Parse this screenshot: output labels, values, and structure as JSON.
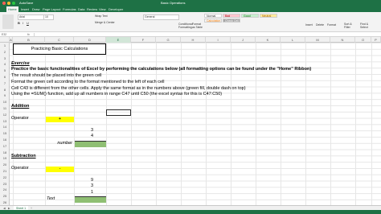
{
  "window": {
    "title": "Basic Operations",
    "autosave_label": "AutoSave"
  },
  "menu": {
    "tabs": [
      "Home",
      "Insert",
      "Draw",
      "Page Layout",
      "Formulas",
      "Data",
      "Review",
      "View",
      "Developer"
    ]
  },
  "ribbon": {
    "font_name": "Arial",
    "font_size": "10",
    "wrap_text_label": "Wrap Text",
    "merge_label": "Merge & Center",
    "number_format": "General",
    "cond_format_label": "Conditional Formatting",
    "format_table_label": "Format as Table",
    "styles": [
      "Normal",
      "Bad",
      "Good",
      "Neutral",
      "Calculation",
      "Check Cell"
    ],
    "insert_label": "Insert",
    "delete_label": "Delete",
    "format_label": "Format",
    "sort_label": "Sort & Filter",
    "find_label": "Find & Select"
  },
  "formula_bar": {
    "name_box": "E32",
    "fx": "fx"
  },
  "columns": [
    "A",
    "B",
    "C",
    "D",
    "E",
    "F",
    "G",
    "H",
    "I",
    "J",
    "K",
    "L",
    "M",
    "N",
    "O",
    "P"
  ],
  "rows": [
    "1",
    "2",
    "3",
    "4",
    "5",
    "6",
    "7",
    "8",
    "9",
    "10",
    "11",
    "12",
    "13",
    "14",
    "15",
    "16",
    "17",
    "18",
    "19",
    "20",
    "21",
    "22",
    "23",
    "24",
    "25",
    "26"
  ],
  "sheet": {
    "title": "Practicing Basic Calculations",
    "exercise_heading": "Exercise",
    "intro": "Practice the basic functionalities of Excel by performing the calculations below (all formatting options can be found under the \"Home\" Ribbon)",
    "bullets": [
      "The result should be placed into the green cell",
      "Format the green cell according to the format mentioned to the left of each cell",
      "Cell C43 is different from the other cells. Apply the same format as in the numbers above (green fill, double dash on top)",
      "Using the =SUM() function, add up all numbers in range C47 until C50 (the excel syntax for this is C47:C50)"
    ],
    "addition_heading": "Addition",
    "operator_label": "Operator",
    "addition_operator": "+",
    "addition_values": [
      "3",
      "4"
    ],
    "addition_format": "number",
    "subtraction_heading": "Subtraction",
    "subtraction_operator": "-",
    "subtraction_values": [
      "9",
      "3",
      "1"
    ],
    "subtraction_format": "Text"
  },
  "sheet_tabs": [
    "Sheet 1"
  ],
  "colors": {
    "excel_green": "#1e7145",
    "result_green": "#8fbf73",
    "operator_yellow": "#ffff00"
  }
}
